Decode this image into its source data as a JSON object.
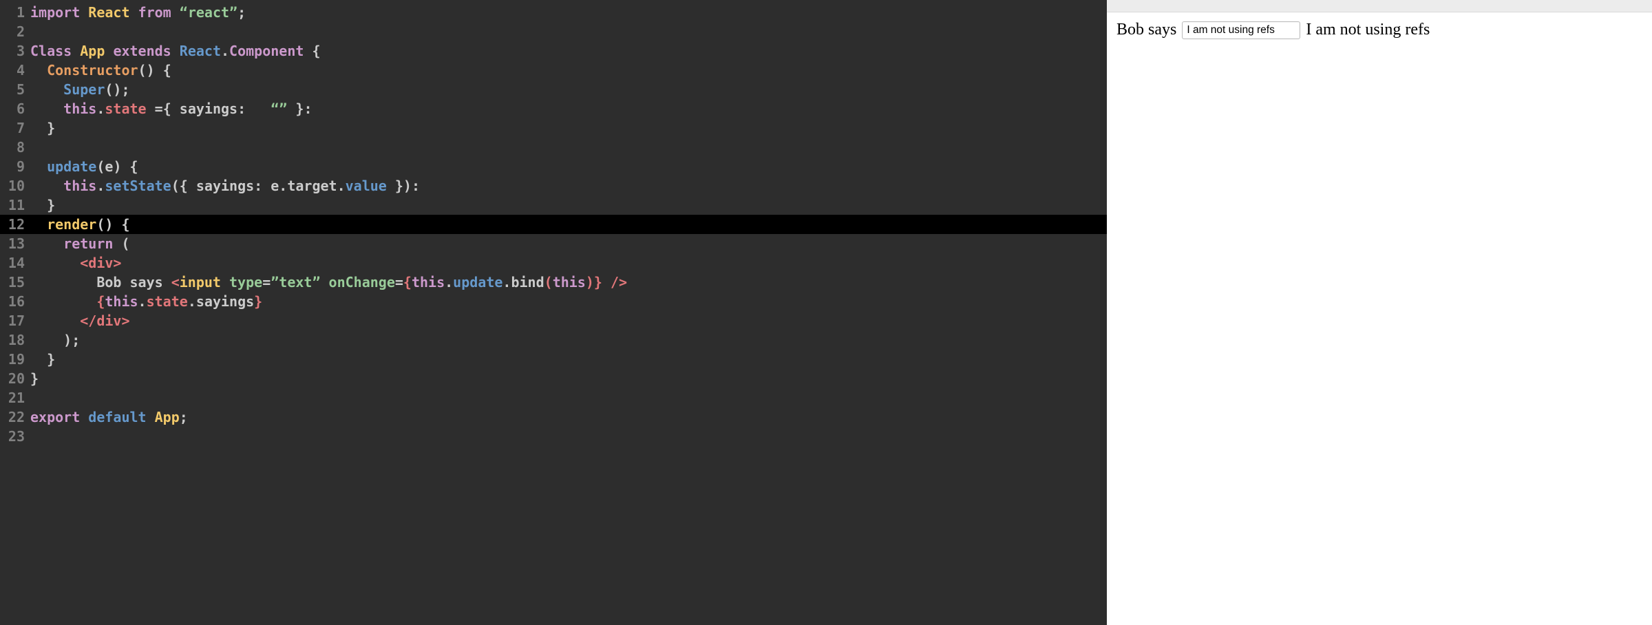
{
  "editor": {
    "active_line": 12,
    "lines": [
      {
        "n": 1,
        "tokens": [
          [
            "kw",
            "import"
          ],
          [
            "plain",
            " "
          ],
          [
            "mod",
            "React"
          ],
          [
            "plain",
            " "
          ],
          [
            "kw",
            "from"
          ],
          [
            "plain",
            " "
          ],
          [
            "str",
            "“react”"
          ],
          [
            "punc",
            ";"
          ]
        ]
      },
      {
        "n": 2,
        "tokens": []
      },
      {
        "n": 3,
        "tokens": [
          [
            "kw",
            "Class"
          ],
          [
            "plain",
            " "
          ],
          [
            "mod",
            "App"
          ],
          [
            "plain",
            " "
          ],
          [
            "kw",
            "extends"
          ],
          [
            "plain",
            " "
          ],
          [
            "id",
            "React"
          ],
          [
            "punc",
            "."
          ],
          [
            "comp",
            "Component"
          ],
          [
            "plain",
            " "
          ],
          [
            "punc",
            "{"
          ]
        ]
      },
      {
        "n": 4,
        "tokens": [
          [
            "plain",
            "  "
          ],
          [
            "fn",
            "Constructor"
          ],
          [
            "punc",
            "()"
          ],
          [
            "plain",
            " "
          ],
          [
            "punc",
            "{"
          ]
        ]
      },
      {
        "n": 5,
        "tokens": [
          [
            "plain",
            "    "
          ],
          [
            "id",
            "Super"
          ],
          [
            "punc",
            "();"
          ]
        ]
      },
      {
        "n": 6,
        "tokens": [
          [
            "plain",
            "    "
          ],
          [
            "kw",
            "this"
          ],
          [
            "punc",
            "."
          ],
          [
            "state",
            "state"
          ],
          [
            "plain",
            " "
          ],
          [
            "op",
            "="
          ],
          [
            "punc",
            "{"
          ],
          [
            "plain",
            " "
          ],
          [
            "plain",
            "sayings:"
          ],
          [
            "plain",
            "   "
          ],
          [
            "str",
            "“”"
          ],
          [
            "plain",
            " "
          ],
          [
            "punc",
            "}"
          ],
          [
            "op",
            ":"
          ]
        ]
      },
      {
        "n": 7,
        "tokens": [
          [
            "plain",
            "  "
          ],
          [
            "punc",
            "}"
          ]
        ]
      },
      {
        "n": 8,
        "tokens": []
      },
      {
        "n": 9,
        "tokens": [
          [
            "plain",
            "  "
          ],
          [
            "id",
            "update"
          ],
          [
            "punc",
            "("
          ],
          [
            "plain",
            "e"
          ],
          [
            "punc",
            ")"
          ],
          [
            "plain",
            " "
          ],
          [
            "punc",
            "{"
          ]
        ]
      },
      {
        "n": 10,
        "tokens": [
          [
            "plain",
            "    "
          ],
          [
            "kw",
            "this"
          ],
          [
            "punc",
            "."
          ],
          [
            "id",
            "setState"
          ],
          [
            "punc",
            "({"
          ],
          [
            "plain",
            " "
          ],
          [
            "plain",
            "sayings:"
          ],
          [
            "plain",
            " "
          ],
          [
            "plain",
            "e"
          ],
          [
            "punc",
            "."
          ],
          [
            "plain",
            "target"
          ],
          [
            "punc",
            "."
          ],
          [
            "id",
            "value"
          ],
          [
            "plain",
            " "
          ],
          [
            "punc",
            "})"
          ],
          [
            "op",
            ":"
          ]
        ]
      },
      {
        "n": 11,
        "tokens": [
          [
            "plain",
            "  "
          ],
          [
            "punc",
            "}"
          ]
        ]
      },
      {
        "n": 12,
        "tokens": [
          [
            "plain",
            "  "
          ],
          [
            "attr",
            "render"
          ],
          [
            "punc",
            "()"
          ],
          [
            "plain",
            " "
          ],
          [
            "punc",
            "{"
          ]
        ]
      },
      {
        "n": 13,
        "tokens": [
          [
            "plain",
            "    "
          ],
          [
            "kw",
            "return"
          ],
          [
            "plain",
            " "
          ],
          [
            "punc",
            "("
          ]
        ]
      },
      {
        "n": 14,
        "tokens": [
          [
            "plain",
            "      "
          ],
          [
            "tag",
            "<div>"
          ]
        ]
      },
      {
        "n": 15,
        "tokens": [
          [
            "plain",
            "        "
          ],
          [
            "plain",
            "Bob says "
          ],
          [
            "tag",
            "<"
          ],
          [
            "attr",
            "input"
          ],
          [
            "plain",
            " "
          ],
          [
            "jsxattr",
            "type"
          ],
          [
            "op",
            "="
          ],
          [
            "str",
            "”text”"
          ],
          [
            "plain",
            " "
          ],
          [
            "jsxattr",
            "onChange"
          ],
          [
            "op",
            "="
          ],
          [
            "tag",
            "{"
          ],
          [
            "kw",
            "this"
          ],
          [
            "punc",
            "."
          ],
          [
            "id",
            "update"
          ],
          [
            "punc",
            "."
          ],
          [
            "plain",
            "bind"
          ],
          [
            "tag",
            "("
          ],
          [
            "kw",
            "this"
          ],
          [
            "tag",
            ")}"
          ],
          [
            "plain",
            " "
          ],
          [
            "tag",
            "/>"
          ]
        ]
      },
      {
        "n": 16,
        "tokens": [
          [
            "plain",
            "        "
          ],
          [
            "tag",
            "{"
          ],
          [
            "kw",
            "this"
          ],
          [
            "punc",
            "."
          ],
          [
            "state",
            "state"
          ],
          [
            "punc",
            "."
          ],
          [
            "plain",
            "sayings"
          ],
          [
            "tag",
            "}"
          ]
        ]
      },
      {
        "n": 17,
        "tokens": [
          [
            "plain",
            "      "
          ],
          [
            "tag",
            "</div>"
          ]
        ]
      },
      {
        "n": 18,
        "tokens": [
          [
            "plain",
            "    "
          ],
          [
            "punc",
            ");"
          ]
        ]
      },
      {
        "n": 19,
        "tokens": [
          [
            "plain",
            "  "
          ],
          [
            "punc",
            "}"
          ]
        ]
      },
      {
        "n": 20,
        "tokens": [
          [
            "punc",
            "}"
          ]
        ]
      },
      {
        "n": 21,
        "tokens": []
      },
      {
        "n": 22,
        "tokens": [
          [
            "kw",
            "export"
          ],
          [
            "plain",
            " "
          ],
          [
            "id",
            "default"
          ],
          [
            "plain",
            " "
          ],
          [
            "mod",
            "App"
          ],
          [
            "punc",
            ";"
          ]
        ]
      },
      {
        "n": 23,
        "tokens": []
      }
    ]
  },
  "preview": {
    "label": "Bob says",
    "input_value": "I am not using refs",
    "echo_text": "I am not using refs"
  }
}
